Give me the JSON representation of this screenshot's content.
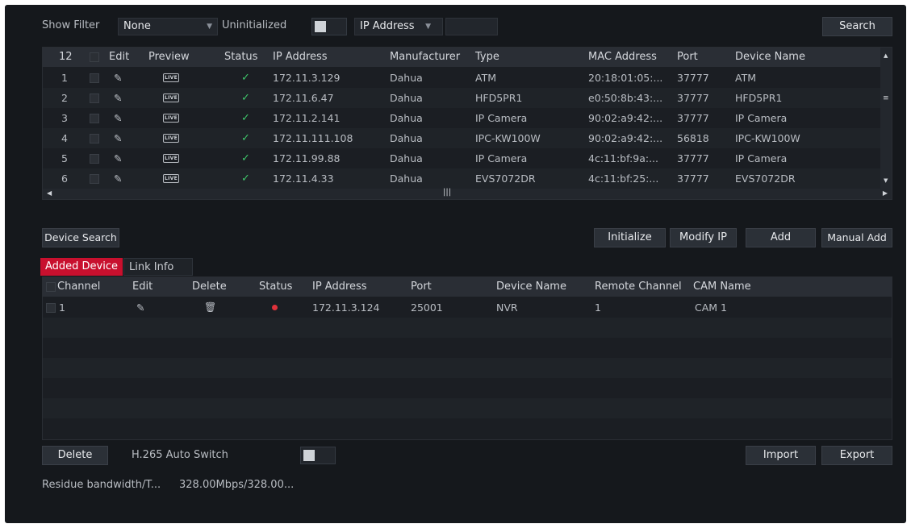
{
  "filter": {
    "show_filter_label": "Show Filter",
    "show_filter_value": "None",
    "uninitialized_label": "Uninitialized",
    "search_type_value": "IP Address",
    "search_text_value": "",
    "search_button": "Search"
  },
  "device_table": {
    "count": "12",
    "headers": [
      "Edit",
      "Preview",
      "Status",
      "IP Address",
      "Manufacturer",
      "Type",
      "MAC Address",
      "Port",
      "Device Name"
    ],
    "rows": [
      {
        "no": "1",
        "ip": "172.11.3.129",
        "manufacturer": "Dahua",
        "type": "ATM",
        "mac": "20:18:01:05:...",
        "port": "37777",
        "name": "ATM"
      },
      {
        "no": "2",
        "ip": "172.11.6.47",
        "manufacturer": "Dahua",
        "type": "HFD5PR1",
        "mac": "e0:50:8b:43:...",
        "port": "37777",
        "name": "HFD5PR1"
      },
      {
        "no": "3",
        "ip": "172.11.2.141",
        "manufacturer": "Dahua",
        "type": "IP Camera",
        "mac": "90:02:a9:42:...",
        "port": "37777",
        "name": "IP Camera"
      },
      {
        "no": "4",
        "ip": "172.11.111.108",
        "manufacturer": "Dahua",
        "type": "IPC-KW100W",
        "mac": "90:02:a9:42:...",
        "port": "56818",
        "name": "IPC-KW100W"
      },
      {
        "no": "5",
        "ip": "172.11.99.88",
        "manufacturer": "Dahua",
        "type": "IP Camera",
        "mac": "4c:11:bf:9a:...",
        "port": "37777",
        "name": "IP Camera"
      },
      {
        "no": "6",
        "ip": "172.11.4.33",
        "manufacturer": "Dahua",
        "type": "EVS7072DR",
        "mac": "4c:11:bf:25:...",
        "port": "37777",
        "name": "EVS7072DR"
      }
    ],
    "live_badge": "LIVE",
    "status_icon": "checkmark-icon"
  },
  "actions": {
    "device_search": "Device Search",
    "initialize": "Initialize",
    "modify_ip": "Modify IP",
    "add": "Add",
    "manual_add": "Manual Add"
  },
  "tabs": {
    "added_device": "Added Device",
    "link_info": "Link Info"
  },
  "added_table": {
    "headers": [
      "Channel",
      "Edit",
      "Delete",
      "Status",
      "IP Address",
      "Port",
      "Device Name",
      "Remote Channel",
      "CAM Name"
    ],
    "rows": [
      {
        "channel": "1",
        "ip": "172.11.3.124",
        "port": "25001",
        "name": "NVR",
        "remote_channel": "1",
        "cam_name": "CAM 1"
      }
    ]
  },
  "footer": {
    "delete": "Delete",
    "h265_label": "H.265 Auto Switch",
    "import": "Import",
    "export": "Export",
    "bandwidth_label": "Residue bandwidth/T...",
    "bandwidth_value": "328.00Mbps/328.00..."
  },
  "colors": {
    "background": "#15181c",
    "accent_tab": "#c8102e",
    "status_ok": "#3fc56a",
    "status_offline": "#e0323b"
  }
}
